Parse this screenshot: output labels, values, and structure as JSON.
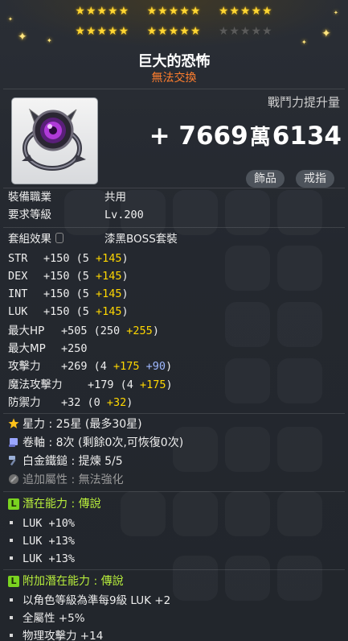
{
  "header": {
    "stars": [
      "★★★★★",
      "★★★★★",
      "★★★★★",
      "★★★★★",
      "★★★★★",
      "★★★★★"
    ],
    "name": "巨大的恐怖",
    "trade": "無法交換"
  },
  "power": {
    "label": "戰鬥力提升量",
    "plus": "+",
    "high": "7669",
    "wan": "萬",
    "low": "6134"
  },
  "tags": [
    "飾品",
    "戒指"
  ],
  "basic": {
    "job_label": "裝備職業",
    "job_value": "共用",
    "level_label": "要求等級",
    "level_value": "Lv.200",
    "set_label": "套組效果",
    "set_value": "漆黑BOSS套裝"
  },
  "stats": [
    {
      "name": "STR",
      "base": "+150",
      "open": " (5 ",
      "bonus": "+145",
      "close": ")"
    },
    {
      "name": "DEX",
      "base": "+150",
      "open": " (5 ",
      "bonus": "+145",
      "close": ")"
    },
    {
      "name": "INT",
      "base": "+150",
      "open": " (5 ",
      "bonus": "+145",
      "close": ")"
    },
    {
      "name": "LUK",
      "base": "+150",
      "open": " (5 ",
      "bonus": "+145",
      "close": ")"
    },
    {
      "name": "最大HP",
      "base": "+505",
      "open": " (250 ",
      "bonus": "+255",
      "close": ")"
    },
    {
      "name": "最大MP",
      "base": "+250",
      "open": "",
      "bonus": "",
      "close": ""
    },
    {
      "name": "攻擊力",
      "base": "+269",
      "open": " (4 ",
      "bonus": "+175",
      "extra": " +90",
      "close": ")"
    },
    {
      "name": "魔法攻擊力",
      "base": "+179",
      "open": " (4 ",
      "bonus": "+175",
      "close": ")"
    },
    {
      "name": "防禦力",
      "base": "+32",
      "open": " (0 ",
      "bonus": "+32",
      "close": ")"
    }
  ],
  "enhance": {
    "star_label": "星力 : ",
    "star_value": "25星 (最多30星)",
    "scroll_label": "卷軸 : ",
    "scroll_value": "8次 (剩餘0次,可恢復0次)",
    "hammer_label": "白金鐵鎚 : ",
    "hammer_value": "提煉 5/5",
    "addopt_label": "追加屬性 : ",
    "addopt_value": "無法強化"
  },
  "potential": {
    "grade": "L",
    "title": "潛在能力 : 傳說",
    "lines": [
      "LUK +10%",
      "LUK +13%",
      "LUK +13%"
    ]
  },
  "bonus_potential": {
    "grade": "L",
    "title": "附加潛在能力 : 傳說",
    "lines": [
      "以角色等級為準每9級 LUK +2",
      "全屬性 +5%",
      "物理攻擊力 +14"
    ]
  },
  "colors": {
    "accent": "#ffd700",
    "trade": "#ff7e2e",
    "legend": "#b8ee3c",
    "blue": "#9fb8ff"
  },
  "icons": [
    "star-icon",
    "scroll-icon",
    "hammer-icon",
    "add-option-icon",
    "lock-icon",
    "ring-item-icon"
  ]
}
